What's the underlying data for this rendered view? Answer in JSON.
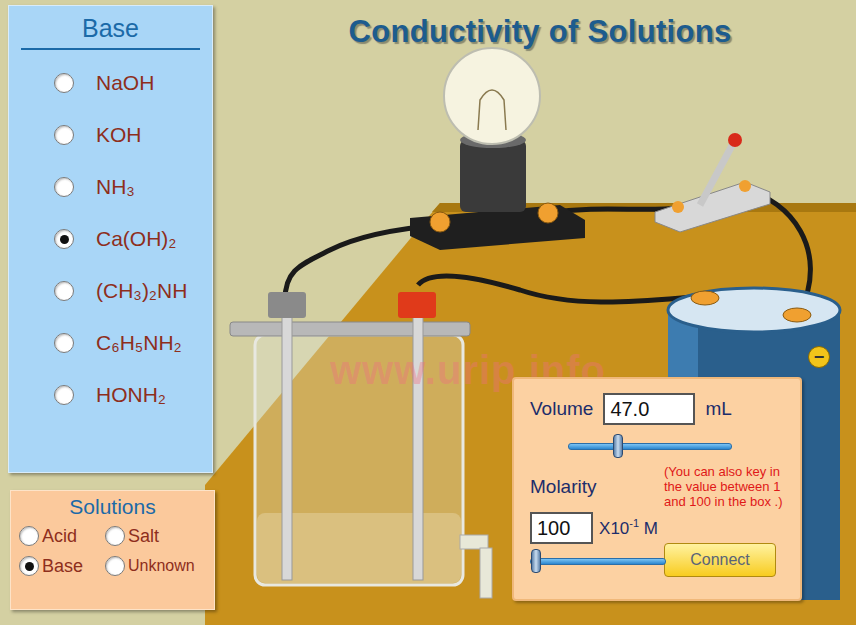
{
  "title": "Conductivity of Solutions",
  "watermark": "www.urip.info",
  "base_panel": {
    "title": "Base",
    "items": [
      {
        "label": "NaOH",
        "selected": false
      },
      {
        "label": "KOH",
        "selected": false
      },
      {
        "label": "NH₃",
        "selected": false
      },
      {
        "label": "Ca(OH)₂",
        "selected": true
      },
      {
        "label": "(CH₃)₂NH",
        "selected": false
      },
      {
        "label": "C₆H₅NH₂",
        "selected": false
      },
      {
        "label": "HONH₂",
        "selected": false
      }
    ]
  },
  "solutions": {
    "title": "Solutions",
    "items": [
      {
        "label": "Acid",
        "selected": false
      },
      {
        "label": "Salt",
        "selected": false
      },
      {
        "label": "Base",
        "selected": true
      },
      {
        "label": "Unknown",
        "selected": false
      }
    ]
  },
  "apparatus": {
    "bulb_lit": false,
    "switch_on": false,
    "battery_sign": "−"
  },
  "controls": {
    "volume_label": "Volume",
    "volume_value": "47.0",
    "volume_unit": "mL",
    "volume_level": 0.3,
    "molarity_label": "Molarity",
    "hint": "(You can also key in the value between 1 and 100 in the box .)",
    "molarity_value": "100",
    "molarity_unit_base": "X10",
    "molarity_unit_exp": "-1",
    "molarity_unit": "M",
    "molarity_level": 0.0,
    "connect_button": "Connect"
  }
}
